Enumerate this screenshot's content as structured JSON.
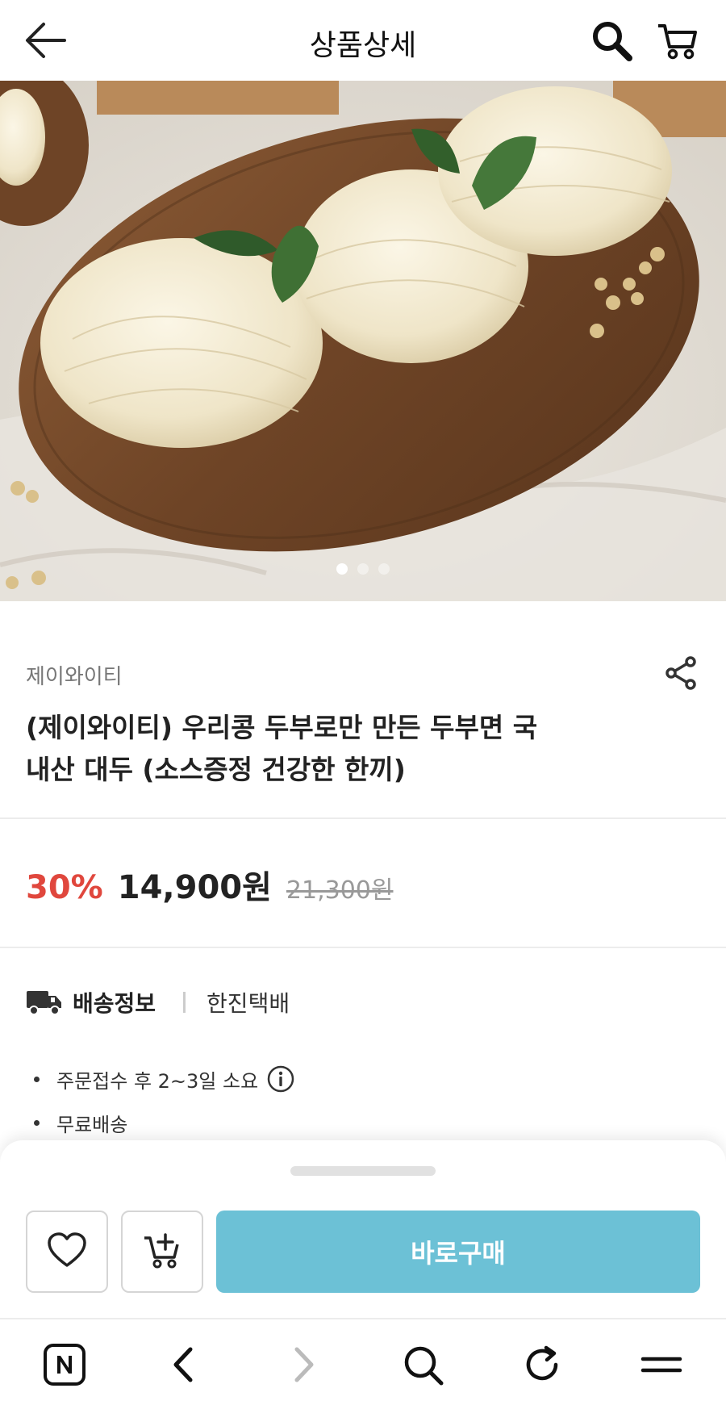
{
  "header": {
    "title": "상품상세",
    "back_icon": "arrow-left-icon",
    "search_icon": "search-icon",
    "cart_icon": "cart-icon"
  },
  "hero": {
    "slide_count": 3,
    "active_slide": 1
  },
  "product": {
    "brand": "제이와이티",
    "name_line1": "(제이와이티) 우리콩 두부로만 만든 두부면 국",
    "name_line2": "내산 대두 (소스증정 건강한 한끼)",
    "discount": "30%",
    "price": "14,900원",
    "original_price": "21,300원"
  },
  "shipping": {
    "label": "배송정보",
    "carrier": "한진택배",
    "notes": [
      "주문접수 후 2~3일 소요",
      "무료배송"
    ]
  },
  "actions": {
    "buy_label": "바로구매",
    "wish_icon": "heart-icon",
    "add_cart_icon": "cart-plus-icon"
  },
  "browser_nav": {
    "icons": [
      "naver-home-icon",
      "back-chevron-icon",
      "forward-chevron-icon",
      "search-icon",
      "refresh-icon",
      "menu-icon"
    ]
  },
  "colors": {
    "discount": "#e0473d",
    "buy_button": "#6cc1d6"
  }
}
